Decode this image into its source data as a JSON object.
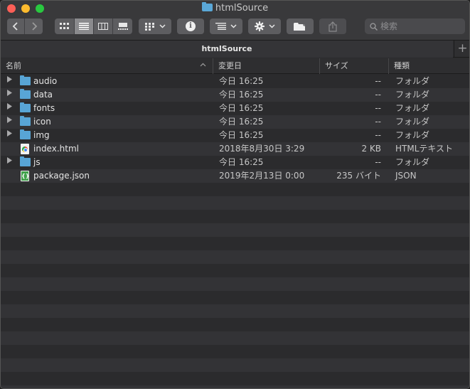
{
  "window": {
    "title": "htmlSource"
  },
  "toolbar": {
    "search_placeholder": "検索",
    "info_glyph": "i"
  },
  "tab": {
    "label": "htmlSource",
    "add_glyph": "+"
  },
  "columns": {
    "name": "名前",
    "date": "変更日",
    "size": "サイズ",
    "kind": "種類"
  },
  "files": [
    {
      "name": "audio",
      "date": "今日 16:25",
      "size": "--",
      "kind": "フォルダ",
      "type": "folder"
    },
    {
      "name": "data",
      "date": "今日 16:25",
      "size": "--",
      "kind": "フォルダ",
      "type": "folder"
    },
    {
      "name": "fonts",
      "date": "今日 16:25",
      "size": "--",
      "kind": "フォルダ",
      "type": "folder"
    },
    {
      "name": "icon",
      "date": "今日 16:25",
      "size": "--",
      "kind": "フォルダ",
      "type": "folder"
    },
    {
      "name": "img",
      "date": "今日 16:25",
      "size": "--",
      "kind": "フォルダ",
      "type": "folder"
    },
    {
      "name": "index.html",
      "date": "2018年8月30日 3:29",
      "size": "2 KB",
      "kind": "HTMLテキスト",
      "type": "html"
    },
    {
      "name": "js",
      "date": "今日 16:25",
      "size": "--",
      "kind": "フォルダ",
      "type": "folder"
    },
    {
      "name": "package.json",
      "date": "2019年2月13日 0:00",
      "size": "235 バイト",
      "kind": "JSON",
      "type": "json"
    }
  ],
  "colors": {
    "window_bg": "#2b2b2d",
    "row_alt": "#333336",
    "folder": "#58a5d6",
    "close": "#fc5f57",
    "minimize": "#fdbb2e",
    "maximize": "#29c840"
  }
}
